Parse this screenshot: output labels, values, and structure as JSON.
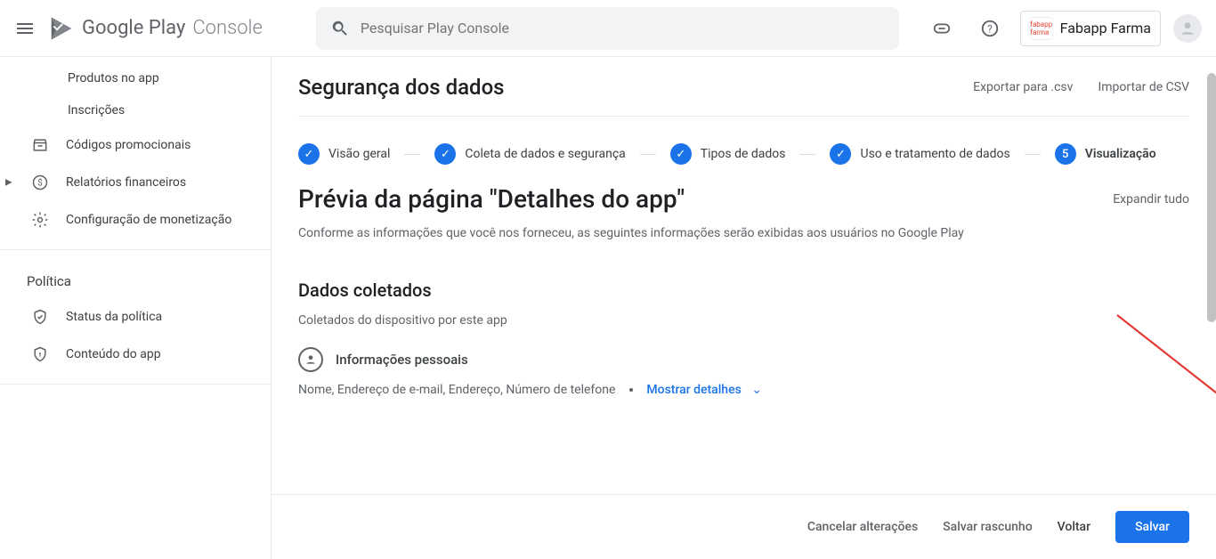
{
  "brand": {
    "name1": "Google Play",
    "name2": " Console"
  },
  "search": {
    "placeholder": "Pesquisar Play Console"
  },
  "account": {
    "app_name": "Fabapp Farma",
    "mini_label": "fabapp\nfarma"
  },
  "sidebar": {
    "items": [
      {
        "label": "Produtos no app"
      },
      {
        "label": "Inscrições"
      }
    ],
    "promos": "Códigos promocionais",
    "finance": "Relatórios financeiros",
    "monetization": "Configuração de monetização",
    "policy_header": "Política",
    "policy_status": "Status da política",
    "app_content": "Conteúdo do app"
  },
  "page": {
    "title": "Segurança dos dados",
    "export_csv": "Exportar para .csv",
    "import_csv": "Importar de CSV"
  },
  "steps": [
    {
      "label": "Visão geral",
      "type": "check"
    },
    {
      "label": "Coleta de dados e segurança",
      "type": "check"
    },
    {
      "label": "Tipos de dados",
      "type": "check"
    },
    {
      "label": "Uso e tratamento de dados",
      "type": "check"
    },
    {
      "label": "Visualização",
      "type": "number",
      "n": "5",
      "bold": true
    }
  ],
  "preview": {
    "title": "Prévia da página \"Detalhes do app\"",
    "expand": "Expandir tudo",
    "desc": "Conforme as informações que você nos forneceu, as seguintes informações serão exibidas aos usuários no Google Play"
  },
  "collected": {
    "title": "Dados coletados",
    "sub": "Coletados do dispositivo por este app",
    "group_label": "Informações pessoais",
    "list": "Nome, Endereço de e-mail, Endereço, Número de telefone",
    "show_details": "Mostrar detalhes"
  },
  "footer": {
    "cancel": "Cancelar alterações",
    "save_draft": "Salvar rascunho",
    "back": "Voltar",
    "save": "Salvar"
  }
}
